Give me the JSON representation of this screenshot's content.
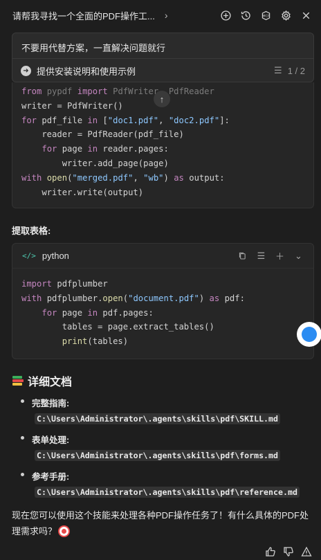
{
  "header": {
    "title": "请帮我寻找一个全面的PDF操作工...",
    "icons": [
      "add-icon",
      "history-icon",
      "mcp-icon",
      "settings-icon",
      "close-icon"
    ],
    "mcp_label": "MCP"
  },
  "query": {
    "text": "不要用代替方案，一直解决问题就行",
    "suggestion": "提供安装说明和使用示例",
    "pager": "1 / 2"
  },
  "code_block_1": {
    "lines": [
      "from pypdf import PdfWriter, PdfReader",
      "writer = PdfWriter()",
      "for pdf_file in [\"doc1.pdf\", \"doc2.pdf\"]:",
      "    reader = PdfReader(pdf_file)",
      "    for page in reader.pages:",
      "        writer.add_page(page)",
      "with open(\"merged.pdf\", \"wb\") as output:",
      "    writer.write(output)"
    ]
  },
  "section_extract_tables": "提取表格:",
  "code_block_2": {
    "language": "python",
    "lang_icon": "</>",
    "lines": [
      "import pdfplumber",
      "with pdfplumber.open(\"document.pdf\") as pdf:",
      "    for page in pdf.pages:",
      "        tables = page.extract_tables()",
      "        print(tables)"
    ]
  },
  "docs": {
    "title": "详细文档",
    "items": [
      {
        "name": "完整指南:",
        "path": "C:\\Users\\Administrator\\.agents\\skills\\pdf\\SKILL.md"
      },
      {
        "name": "表单处理:",
        "path": "C:\\Users\\Administrator\\.agents\\skills\\pdf\\forms.md"
      },
      {
        "name": "参考手册:",
        "path": "C:\\Users\\Administrator\\.agents\\skills\\pdf\\reference.md"
      }
    ]
  },
  "final_message": "现在您可以使用这个技能来处理各种PDF操作任务了！有什么具体的PDF处理需求吗？",
  "colors": {
    "background": "#1e1e1e",
    "keyword": "#c586c0",
    "function": "#dcdcaa",
    "string": "#8ec8ff",
    "float_button": "#2b8cf2"
  }
}
